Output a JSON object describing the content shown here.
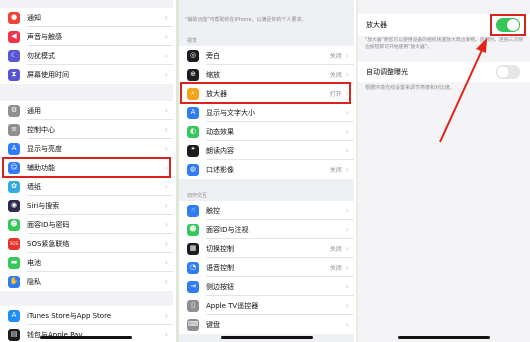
{
  "colors": {
    "highlight": "#d9231c",
    "toggle_on": "#34c759",
    "toggle_off": "#e5e5ea",
    "arrow": "#e2231a"
  },
  "left_settings": {
    "items": [
      {
        "label": "通知",
        "icon": "bell-icon",
        "color": "#f2443a"
      },
      {
        "label": "声音与触感",
        "icon": "speaker-icon",
        "color": "#f0344b"
      },
      {
        "label": "勿扰模式",
        "icon": "moon-icon",
        "color": "#5856d6"
      },
      {
        "label": "屏幕使用时间",
        "icon": "hourglass-icon",
        "color": "#5856d6"
      },
      {
        "label": "通用",
        "icon": "gear-icon",
        "color": "#8e8e93"
      },
      {
        "label": "控制中心",
        "icon": "switches-icon",
        "color": "#8e8e93"
      },
      {
        "label": "显示与亮度",
        "icon": "aa-icon",
        "color": "#2f7cf6"
      },
      {
        "label": "辅助功能",
        "icon": "accessibility-icon",
        "color": "#2f7cf6"
      },
      {
        "label": "墙纸",
        "icon": "flower-icon",
        "color": "#35aadc"
      },
      {
        "label": "Siri与搜索",
        "icon": "siri-icon",
        "color": "#2b2b52"
      },
      {
        "label": "面容ID与密码",
        "icon": "face-id-icon",
        "color": "#34c759"
      },
      {
        "label": "SOS紧急联络",
        "icon": "sos-icon",
        "color": "#e5352d"
      },
      {
        "label": "电池",
        "icon": "battery-icon",
        "color": "#34c759"
      },
      {
        "label": "隐私",
        "icon": "hand-icon",
        "color": "#2f7cf6"
      },
      {
        "label": "iTunes Store与App Store",
        "icon": "app-store-icon",
        "color": "#1f8ef4"
      },
      {
        "label": "钱包与Apple Pay",
        "icon": "wallet-icon",
        "color": "#1c1c1e"
      }
    ]
  },
  "accessibility": {
    "intro": "\"辅助功能\"可帮助你在iPhone，以满足你的个人要求。",
    "vision_header": "视觉",
    "vision_items": [
      {
        "label": "旁白",
        "value": "关闭",
        "icon": "voiceover-icon",
        "color": "#1c1c1e"
      },
      {
        "label": "缩放",
        "value": "关闭",
        "icon": "zoom-icon",
        "color": "#1c1c1e"
      },
      {
        "label": "放大器",
        "value": "打开",
        "icon": "magnifier-icon",
        "color": "#f5a31a"
      },
      {
        "label": "显示与文字大小",
        "value": "",
        "icon": "aa-icon",
        "color": "#2f7cf6"
      },
      {
        "label": "动态效果",
        "value": "",
        "icon": "motion-icon",
        "color": "#34c759"
      },
      {
        "label": "朗读内容",
        "value": "",
        "icon": "speech-bubble-icon",
        "color": "#1c1c1e"
      },
      {
        "label": "口述影像",
        "value": "关闭",
        "icon": "audio-description-icon",
        "color": "#2f7cf6"
      }
    ],
    "interaction_header": "动作交互",
    "interaction_items": [
      {
        "label": "触控",
        "value": "",
        "icon": "touch-icon",
        "color": "#2f7cf6"
      },
      {
        "label": "面容ID与注视",
        "value": "",
        "icon": "face-id-icon",
        "color": "#34c759"
      },
      {
        "label": "切换控制",
        "value": "关闭",
        "icon": "switch-control-icon",
        "color": "#1c1c1e"
      },
      {
        "label": "语音控制",
        "value": "关闭",
        "icon": "voice-control-icon",
        "color": "#2f7cf6"
      },
      {
        "label": "侧边按钮",
        "value": "",
        "icon": "side-button-icon",
        "color": "#2f7cf6"
      },
      {
        "label": "Apple TV遥控器",
        "value": "",
        "icon": "remote-icon",
        "color": "#8e8e93"
      },
      {
        "label": "键盘",
        "value": "",
        "icon": "keyboard-icon",
        "color": "#8e8e93"
      }
    ]
  },
  "magnifier": {
    "title": "放大器",
    "toggle_on": true,
    "description": "\"放大器\"使您可以使用设备的相机快速放大周边事物。启用时，连按三次侧边按钮即可开始使用\"放大器\"。",
    "auto_exposure_label": "自动调整曝光",
    "auto_exposure_on": false,
    "auto_exposure_note": "根据环境光线设置来调节亮度和对比度。"
  }
}
